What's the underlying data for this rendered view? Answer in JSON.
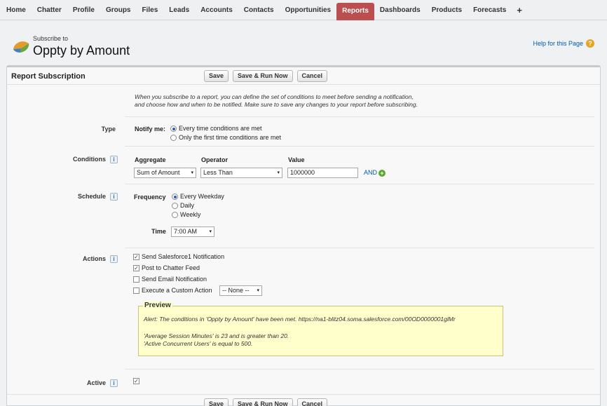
{
  "tabs": [
    {
      "label": "Home",
      "active": false
    },
    {
      "label": "Chatter",
      "active": false
    },
    {
      "label": "Profile",
      "active": false
    },
    {
      "label": "Groups",
      "active": false
    },
    {
      "label": "Files",
      "active": false
    },
    {
      "label": "Leads",
      "active": false
    },
    {
      "label": "Accounts",
      "active": false
    },
    {
      "label": "Contacts",
      "active": false
    },
    {
      "label": "Opportunities",
      "active": false
    },
    {
      "label": "Reports",
      "active": true
    },
    {
      "label": "Dashboards",
      "active": false
    },
    {
      "label": "Products",
      "active": false
    },
    {
      "label": "Forecasts",
      "active": false
    },
    {
      "label": "+",
      "active": false
    }
  ],
  "header": {
    "subtitle": "Subscribe to",
    "title": "Oppty by Amount",
    "help_link": "Help for this Page",
    "help_icon": "?"
  },
  "panel": {
    "title": "Report Subscription",
    "buttons": {
      "save": "Save",
      "save_run": "Save & Run Now",
      "cancel": "Cancel"
    },
    "intro_line1": "When you subscribe to a report, you can define the set of conditions to meet before sending a notification,",
    "intro_line2": "and choose how and when to be notified. Make sure to save any changes to your report before subscribing."
  },
  "type": {
    "label": "Type",
    "notify_label": "Notify me:",
    "options": [
      "Every time conditions are met",
      "Only the first time conditions are met"
    ],
    "selected": 0
  },
  "conditions": {
    "label": "Conditions",
    "info": "i",
    "col_aggregate": "Aggregate",
    "col_operator": "Operator",
    "col_value": "Value",
    "aggregate": "Sum of Amount",
    "operator": "Less Than",
    "value": "1000000",
    "and_link": "AND",
    "add_icon": "+"
  },
  "schedule": {
    "label": "Schedule",
    "info": "i",
    "frequency_label": "Frequency",
    "options": [
      "Every Weekday",
      "Daily",
      "Weekly"
    ],
    "selected": 0,
    "time_label": "Time",
    "time_value": "7:00 AM"
  },
  "actions": {
    "label": "Actions",
    "info": "i",
    "items": [
      {
        "label": "Send Salesforce1 Notification",
        "checked": true
      },
      {
        "label": "Post to Chatter Feed",
        "checked": true
      },
      {
        "label": "Send Email Notification",
        "checked": false
      },
      {
        "label": "Execute a Custom Action",
        "checked": false
      }
    ],
    "custom_action_value": "-- None --"
  },
  "preview": {
    "title": "Preview",
    "line1": "Alert: The conditions in 'Oppty by Amount' have been met. https://na1-blitz04.soma.salesforce.com/00OD0000001glMr",
    "line2": "'Average Session Minutes' is 23 and is greater than 20.",
    "line3": "'Active Concurrent Users' is equal to 500."
  },
  "active": {
    "label": "Active",
    "info": "i",
    "checked": true
  },
  "colors": {
    "active_tab": "#bb4e4e",
    "link": "#015ba7",
    "preview_bg": "#ffffcc"
  },
  "icons": {
    "logo": "reports-logo-icon",
    "check": "✓",
    "arrow": "▾"
  }
}
